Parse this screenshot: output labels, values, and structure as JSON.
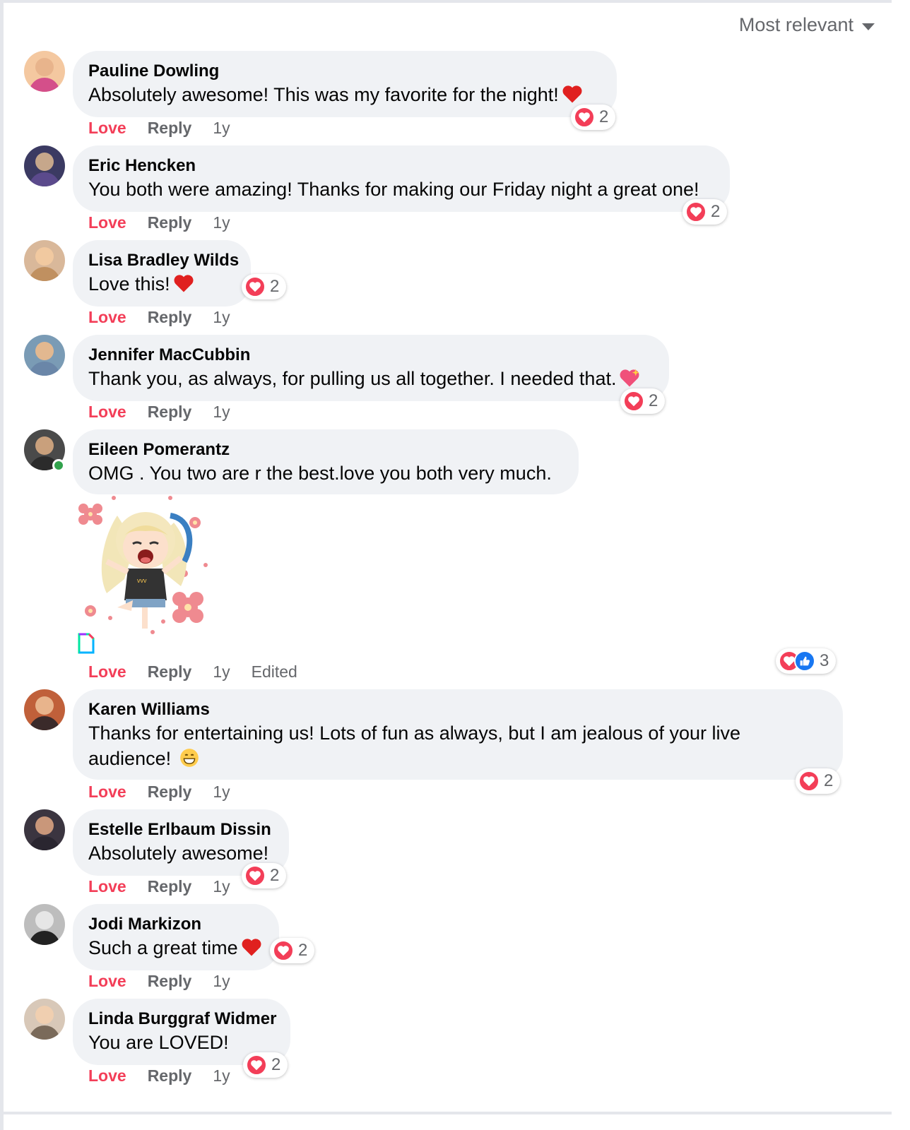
{
  "sort": {
    "label": "Most relevant"
  },
  "actions": {
    "love": "Love",
    "reply": "Reply"
  },
  "colors": {
    "love": "#f33e58",
    "like": "#1877f2",
    "bubble": "#f0f2f5",
    "meta": "#65676b",
    "online": "#31a24c"
  },
  "comments": [
    {
      "author": "Pauline Dowling",
      "text": "Absolutely awesome! This was my favorite for the night!",
      "emoji": "red-heart",
      "reactions": "2",
      "time": "1y"
    },
    {
      "author": "Eric Hencken",
      "text": "You both were amazing! Thanks for making our Friday night a great one!",
      "reactions": "2",
      "time": "1y"
    },
    {
      "author": "Lisa Bradley Wilds",
      "text": "Love this!",
      "emoji": "red-heart",
      "reactions": "2",
      "time": "1y"
    },
    {
      "author": "Jennifer MacCubbin",
      "text": "Thank you, as always, for pulling us all together. I needed that.",
      "emoji": "sparkling-heart",
      "reactions": "2",
      "time": "1y"
    },
    {
      "author": "Eileen Pomerantz",
      "text": "OMG . You two are r the best.love you both very much.",
      "sticker": "cartoon-girl-flowers",
      "reactions": "3",
      "time": "1y",
      "edited": "Edited"
    },
    {
      "author": "Karen Williams",
      "text": "Thanks for entertaining us! Lots of fun as always, but I am jealous of your live audience!",
      "emoji": "grinning-face",
      "reactions": "2",
      "time": "1y"
    },
    {
      "author": "Estelle Erlbaum Dissin",
      "text": "Absolutely awesome!",
      "reactions": "2",
      "time": "1y"
    },
    {
      "author": "Jodi Markizon",
      "text": "Such a great time",
      "emoji": "red-heart",
      "reactions": "2",
      "time": "1y"
    },
    {
      "author": "Linda Burggraf Widmer",
      "text": "You are LOVED!",
      "reactions": "2",
      "time": "1y"
    }
  ]
}
